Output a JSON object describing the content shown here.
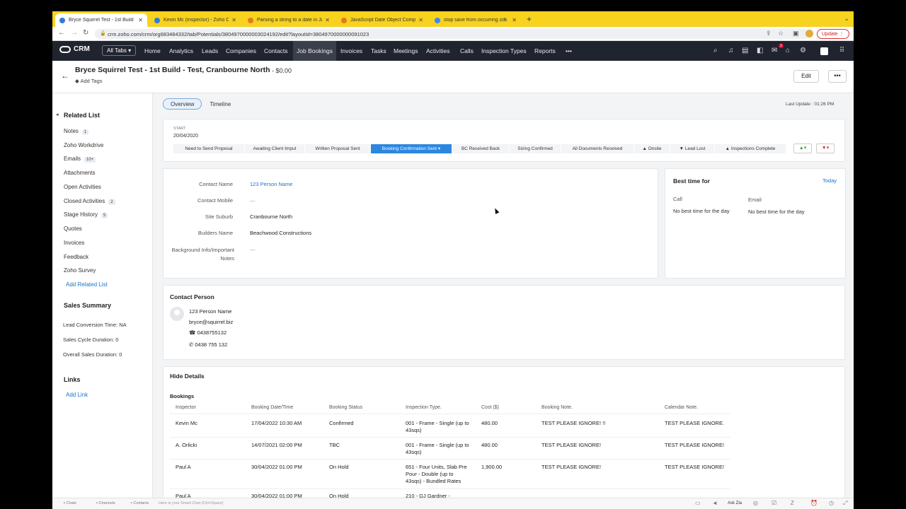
{
  "browser": {
    "tabs": [
      {
        "label": "Bryce Squirrel Test - 1st Build",
        "color": "#2e7be0",
        "active": true
      },
      {
        "label": "Kevin Mc (Inspector) - Zoho CR",
        "color": "#2e7be0"
      },
      {
        "label": "Parsing a string to a date in Ja",
        "color": "#e07b20"
      },
      {
        "label": "JavaScript Date Object Compa",
        "color": "#e07b20"
      },
      {
        "label": "stop save from occurring zdk",
        "color": "#4285f4"
      }
    ],
    "url": "crm.zoho.com/crm/org683484332/tab/Potentials/3804970000003024192/edit?layoutId=3804970000000091023",
    "update_label": "Update"
  },
  "crm": {
    "logo": "CRM",
    "all_tabs": "All Tabs ▾",
    "nav": [
      "Home",
      "Analytics",
      "Leads",
      "Companies",
      "Contacts",
      "Job Bookings",
      "Invoices",
      "Tasks",
      "Meetings",
      "Activities",
      "Calls",
      "Inspection Types",
      "Reports",
      "•••"
    ],
    "notification_count": "3"
  },
  "record": {
    "title": "Bryce Squirrel Test - 1st Build - Test, Cranbourne North",
    "amount": "- $0.00",
    "add_tags": "Add Tags",
    "edit": "Edit",
    "more": "•••"
  },
  "related": {
    "heading": "Related List",
    "items": [
      {
        "label": "Notes",
        "badge": "1"
      },
      {
        "label": "Zoho Workdrive",
        "badge": ""
      },
      {
        "label": "Emails",
        "badge": "10+"
      },
      {
        "label": "Attachments",
        "badge": ""
      },
      {
        "label": "Open Activities",
        "badge": ""
      },
      {
        "label": "Closed Activities",
        "badge": "2"
      },
      {
        "label": "Stage History",
        "badge": "5"
      },
      {
        "label": "Quotes",
        "badge": ""
      },
      {
        "label": "Invoices",
        "badge": ""
      },
      {
        "label": "Feedback",
        "badge": ""
      },
      {
        "label": "Zoho Survey",
        "badge": ""
      }
    ],
    "add_related": "Add Related List",
    "sales_heading": "Sales Summary",
    "sales": [
      "Lead Conversion Time: NA",
      "Sales Cycle Duration: 0",
      "Overall Sales Duration: 0"
    ],
    "links_heading": "Links",
    "add_link": "Add Link"
  },
  "view": {
    "overview": "Overview",
    "timeline": "Timeline",
    "last_update": "Last Update : 01:26 PM"
  },
  "stages": {
    "start_label": "START",
    "start_date": "20/04/2020",
    "items": [
      "Need to Send Proposal",
      "Awaiting Client Imput",
      "Written Proposal Sent",
      "Booking Confirmation Sent ▾",
      "BC Received Back",
      "Sizing Confirmed",
      "All Documents Received",
      "Onsite",
      "Lead Lost",
      "Inspections Complete"
    ],
    "current": 3
  },
  "fields": [
    {
      "label": "Contact Name",
      "value": "123 Person Name"
    },
    {
      "label": "Contact Mobile",
      "value": "—"
    },
    {
      "label": "Site Suburb",
      "value": "Cranbourne North"
    },
    {
      "label": "Builders Name",
      "value": "Beachwood Constructions"
    },
    {
      "label": "Background Info/Important Notes",
      "value": "—"
    }
  ],
  "best_time": {
    "heading": "Best time for",
    "today": "Today",
    "call_label": "Call",
    "call_value": "No best time for the day",
    "email_label": "Email",
    "email_value": "No best time for the day"
  },
  "contact_person": {
    "heading": "Contact Person",
    "name": "123 Person Name",
    "email": "bryce@squirrel.biz",
    "phone": "0438755132",
    "mobile": "0438 755 132"
  },
  "details": {
    "hide_label": "Hide Details",
    "bookings_heading": "Bookings",
    "columns": [
      "Inspector",
      "Booking Date/Time",
      "Booking Status",
      "Inspection Type.",
      "Cost ($)",
      "Booking Note.",
      "Calendar Note."
    ],
    "rows": [
      [
        "Kevin Mc",
        "17/04/2022 10:30 AM",
        "Confirmed",
        "001 - Frame - Single (up to 43sqs)",
        "480.00",
        "TEST PLEASE IGNORE! !!",
        "TEST PLEASE IGNORE."
      ],
      [
        "A. Orlicki",
        "14/07/2021 02:00 PM",
        "TBC",
        "001 - Frame - Single (up to 43sqs)",
        "480.00",
        "TEST PLEASE IGNORE!",
        "TEST PLEASE IGNORE!"
      ],
      [
        "Paul A",
        "30/04/2022 01:00 PM",
        "On Hold",
        "651 - Four Units, Slab Pre Pour - Double (up to 43sqs) - Bundled Rates",
        "1,900.00",
        "TEST PLEASE IGNORE!",
        "TEST PLEASE IGNORE!"
      ],
      [
        "Paul A",
        "30/04/2022 01:00 PM",
        "On Hold",
        "210 - GJ Gardner -",
        "",
        "",
        ""
      ]
    ]
  },
  "bottom": {
    "items": [
      "Chats",
      "Channels",
      "Contacts"
    ],
    "smartchat": "Here is your Smart Chat (Ctrl+Space)",
    "ask_zia": "Ask Zia"
  }
}
